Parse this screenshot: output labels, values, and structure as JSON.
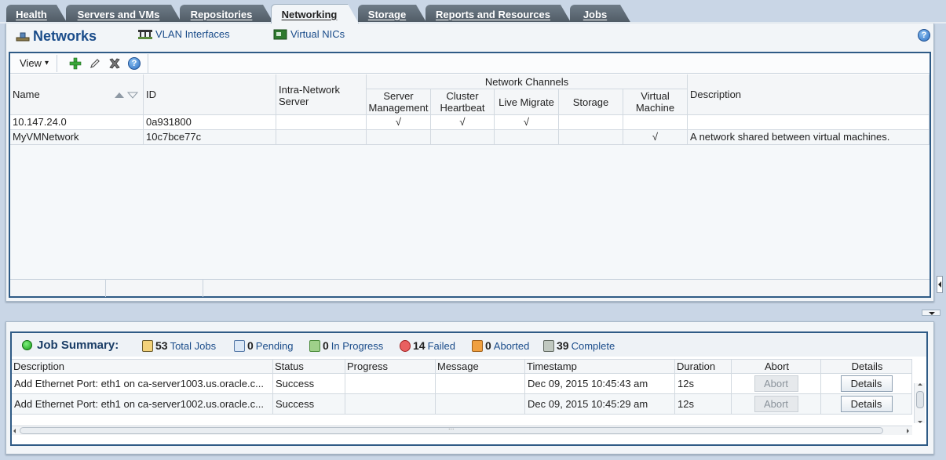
{
  "tabs": [
    {
      "label": "Health"
    },
    {
      "label": "Servers and VMs"
    },
    {
      "label": "Repositories"
    },
    {
      "label": "Networking"
    },
    {
      "label": "Storage"
    },
    {
      "label": "Reports and Resources"
    },
    {
      "label": "Jobs"
    }
  ],
  "active_tab": "Networking",
  "header": {
    "title": "Networks",
    "vlan_link": "VLAN Interfaces",
    "vnic_link": "Virtual NICs",
    "help": "?"
  },
  "toolbar": {
    "view_label": "View",
    "view_arrow": "▾",
    "help": "?"
  },
  "networks_table": {
    "columns": {
      "name": "Name",
      "id": "ID",
      "intra": "Intra-Network Server",
      "channels_group": "Network Channels",
      "server_mgmt": "Server Management",
      "cluster_hb": "Cluster Heartbeat",
      "live_migrate": "Live Migrate",
      "storage": "Storage",
      "vm": "Virtual Machine",
      "description": "Description"
    },
    "rows": [
      {
        "name": "10.147.24.0",
        "id": "0a931800",
        "intra": "",
        "server_mgmt": "√",
        "cluster_hb": "√",
        "live_migrate": "√",
        "storage": "",
        "vm": "",
        "description": ""
      },
      {
        "name": "MyVMNetwork",
        "id": "10c7bce77c",
        "intra": "",
        "server_mgmt": "",
        "cluster_hb": "",
        "live_migrate": "",
        "storage": "",
        "vm": "√",
        "description": "A network shared between virtual machines."
      }
    ]
  },
  "job_summary": {
    "title": "Job Summary:",
    "total": {
      "count": "53",
      "label": "Total Jobs"
    },
    "pending": {
      "count": "0",
      "label": "Pending"
    },
    "in_progress": {
      "count": "0",
      "label": "In Progress"
    },
    "failed": {
      "count": "14",
      "label": "Failed"
    },
    "aborted": {
      "count": "0",
      "label": "Aborted"
    },
    "complete": {
      "count": "39",
      "label": "Complete"
    },
    "columns": {
      "description": "Description",
      "status": "Status",
      "progress": "Progress",
      "message": "Message",
      "timestamp": "Timestamp",
      "duration": "Duration",
      "abort": "Abort",
      "details": "Details"
    },
    "rows": [
      {
        "description": "Add Ethernet Port: eth1 on ca-server1003.us.oracle.c...",
        "status": "Success",
        "progress": "",
        "message": "",
        "timestamp": "Dec 09, 2015 10:45:43 am",
        "duration": "12s",
        "abort": "Abort",
        "details": "Details"
      },
      {
        "description": "Add Ethernet Port: eth1 on ca-server1002.us.oracle.c...",
        "status": "Success",
        "progress": "",
        "message": "",
        "timestamp": "Dec 09, 2015 10:45:29 am",
        "duration": "12s",
        "abort": "Abort",
        "details": "Details"
      }
    ],
    "scroll_grip": "..."
  },
  "colors": {
    "accent": "#1a4c8a",
    "frame": "#2f5b86",
    "tab_inactive": "#5d6974",
    "background": "#c9d6e6"
  }
}
